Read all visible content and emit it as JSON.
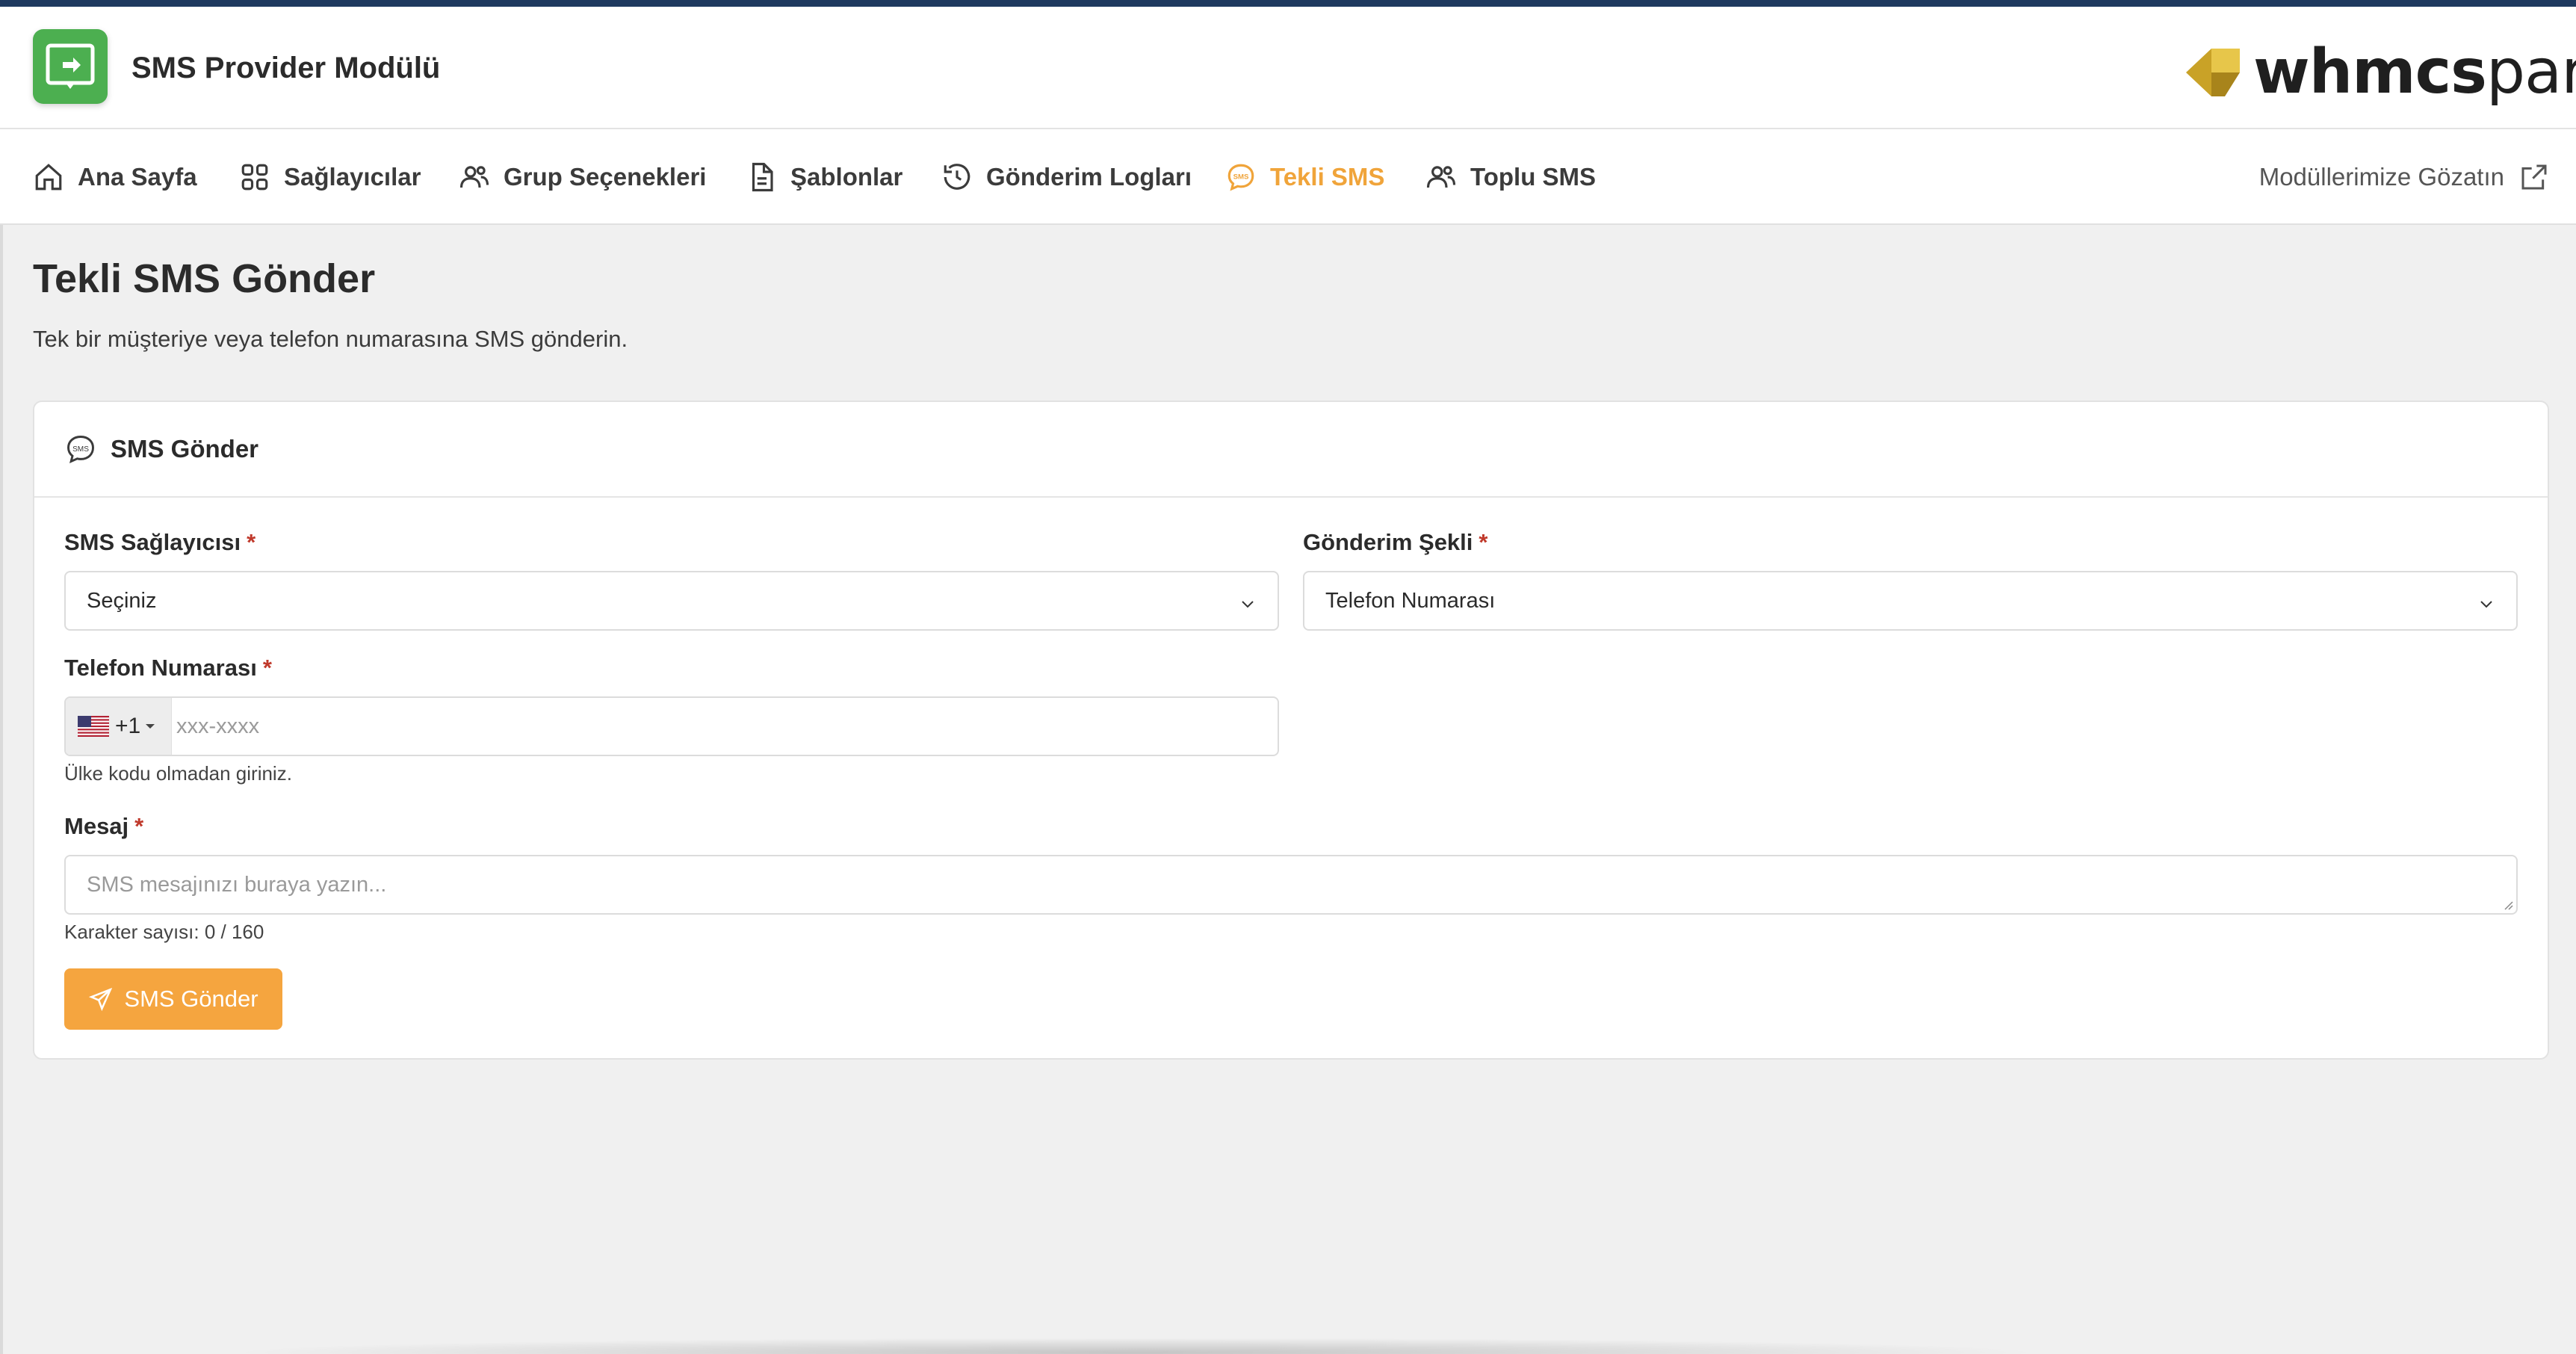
{
  "header": {
    "app_title": "SMS Provider Modülü",
    "brand_bold": "whmcs",
    "brand_light": "park"
  },
  "nav": {
    "items": [
      {
        "label": "Ana Sayfa",
        "icon": "home-icon"
      },
      {
        "label": "Sağlayıcılar",
        "icon": "grid-icon"
      },
      {
        "label": "Grup Seçenekleri",
        "icon": "users-icon"
      },
      {
        "label": "Şablonlar",
        "icon": "file-text-icon"
      },
      {
        "label": "Gönderim Logları",
        "icon": "history-icon"
      },
      {
        "label": "Tekli SMS",
        "icon": "sms-icon",
        "active": true
      },
      {
        "label": "Toplu SMS",
        "icon": "users-icon"
      }
    ],
    "right_link": "Modüllerimize Gözatın"
  },
  "page": {
    "title": "Tekli SMS Gönder",
    "subtitle": "Tek bir müşteriye veya telefon numarasına SMS gönderin."
  },
  "card": {
    "title": "SMS Gönder",
    "provider_label": "SMS Sağlayıcısı",
    "provider_value": "Seçiniz",
    "method_label": "Gönderim Şekli",
    "method_value": "Telefon Numarası",
    "phone_label": "Telefon Numarası",
    "phone_dial_code": "+1",
    "phone_placeholder": "xxx-xxxx",
    "phone_hint": "Ülke kodu olmadan giriniz.",
    "message_label": "Mesaj",
    "message_placeholder": "SMS mesajınızı buraya yazın...",
    "char_count": "Karakter sayısı: 0 / 160",
    "send_button": "SMS Gönder",
    "required_mark": "*"
  },
  "colors": {
    "accent": "#f5a53f",
    "active_nav": "#f0a43a",
    "app_logo": "#4caf50",
    "top_bar": "#1e3a5f",
    "required": "#c0392b"
  }
}
